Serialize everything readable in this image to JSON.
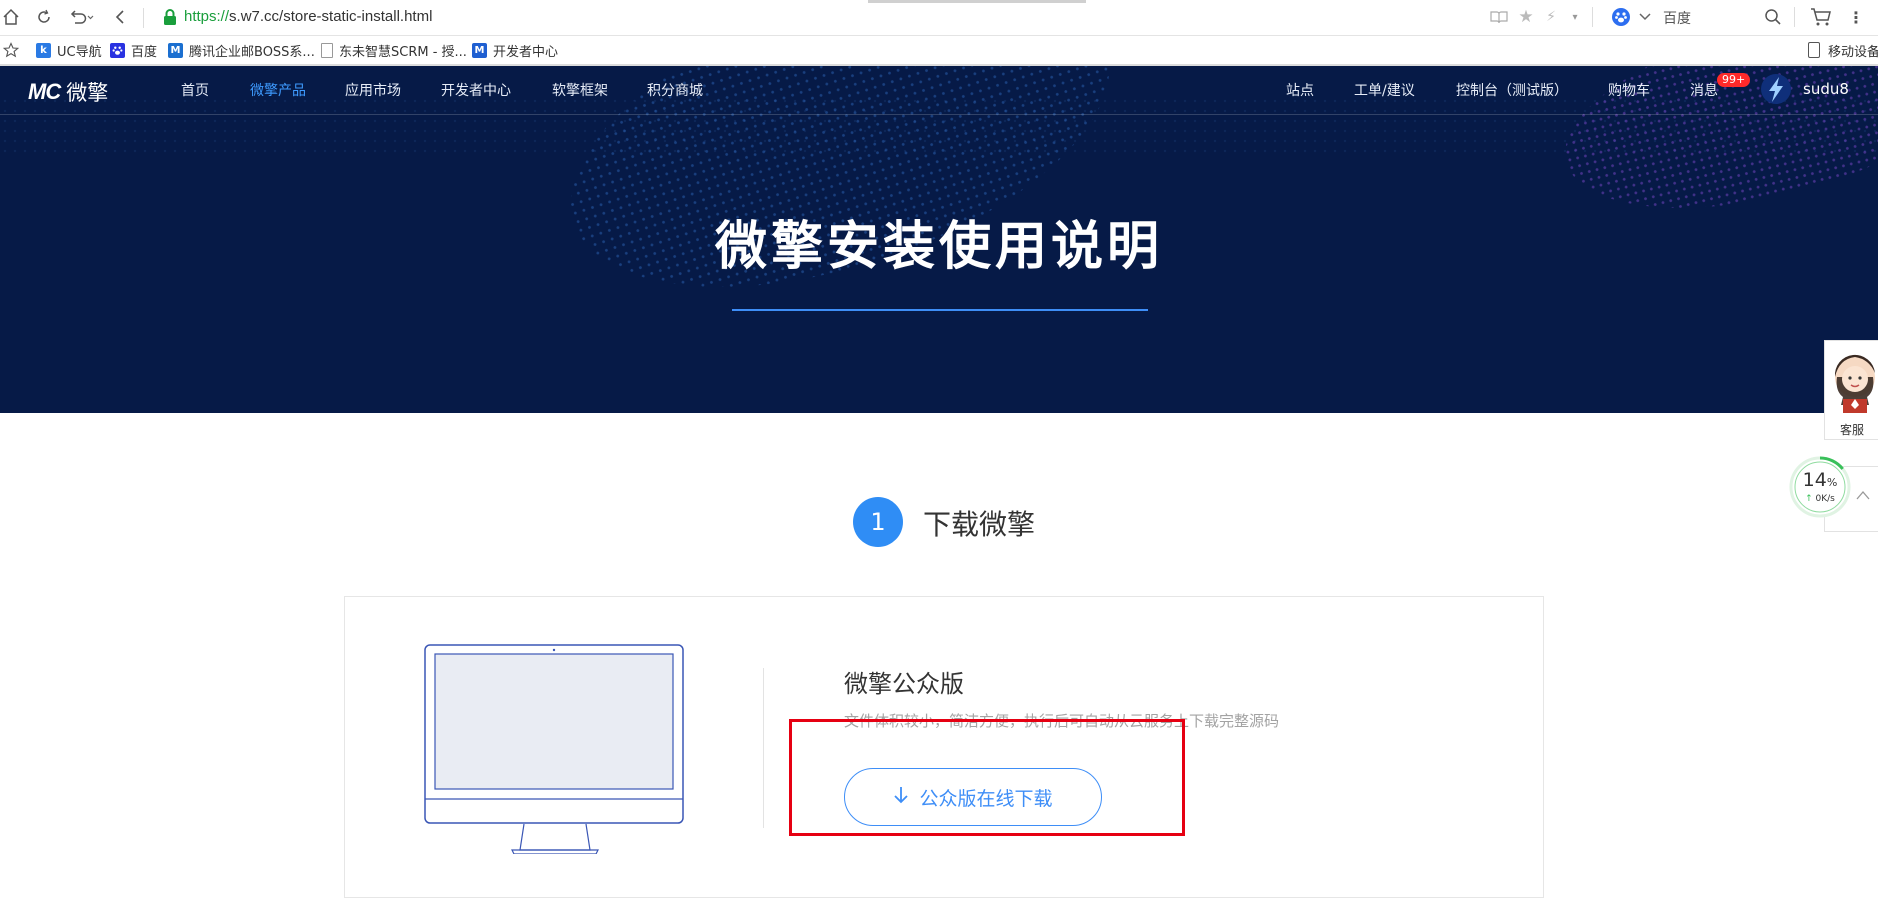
{
  "browser": {
    "url_scheme": "https://",
    "url_rest": "s.w7.cc/store-static-install.html",
    "search_engine": "百度",
    "bookmarks": [
      {
        "label": "UC导航",
        "color": "#2a7ae4",
        "glyph": "k"
      },
      {
        "label": "百度",
        "color": "#2932e1",
        "glyph": "🐾"
      },
      {
        "label": "腾讯企业邮BOSS系...",
        "color": "#1b6fd0",
        "glyph": "M"
      },
      {
        "label": "东未智慧SCRM - 授...",
        "color": "#888888",
        "glyph": ""
      },
      {
        "label": "开发者中心",
        "color": "#1f5fd1",
        "glyph": "M"
      }
    ],
    "mobile_device_label": "移动设备"
  },
  "site": {
    "logo_mark": "MC",
    "logo_name": "微擎",
    "nav_left": [
      "首页",
      "微擎产品",
      "应用市场",
      "开发者中心",
      "软擎框架",
      "积分商城"
    ],
    "active_nav": "微擎产品",
    "nav_right": [
      "站点",
      "工单/建议",
      "控制台（测试版）",
      "购物车",
      "消息"
    ],
    "message_badge": "99+",
    "username": "sudu8",
    "banner_title": "微擎安装使用说明"
  },
  "widgets": {
    "customer_service_label": "客服",
    "speed_percent": "14",
    "speed_unit": "%",
    "speed_rate": "0K/s"
  },
  "content": {
    "step_number": "1",
    "step_title": "下载微擎",
    "edition_title": "微擎公众版",
    "edition_desc": "文件体积较小，简洁方便，执行后可自动从云服务上下载完整源码",
    "download_button": "公众版在线下载"
  },
  "colors": {
    "banner_bg": "#061a47",
    "accent": "#3e8ef7",
    "step_circle": "#2f8df5",
    "highlight_box": "#e60012",
    "badge": "#ff2a2a"
  }
}
